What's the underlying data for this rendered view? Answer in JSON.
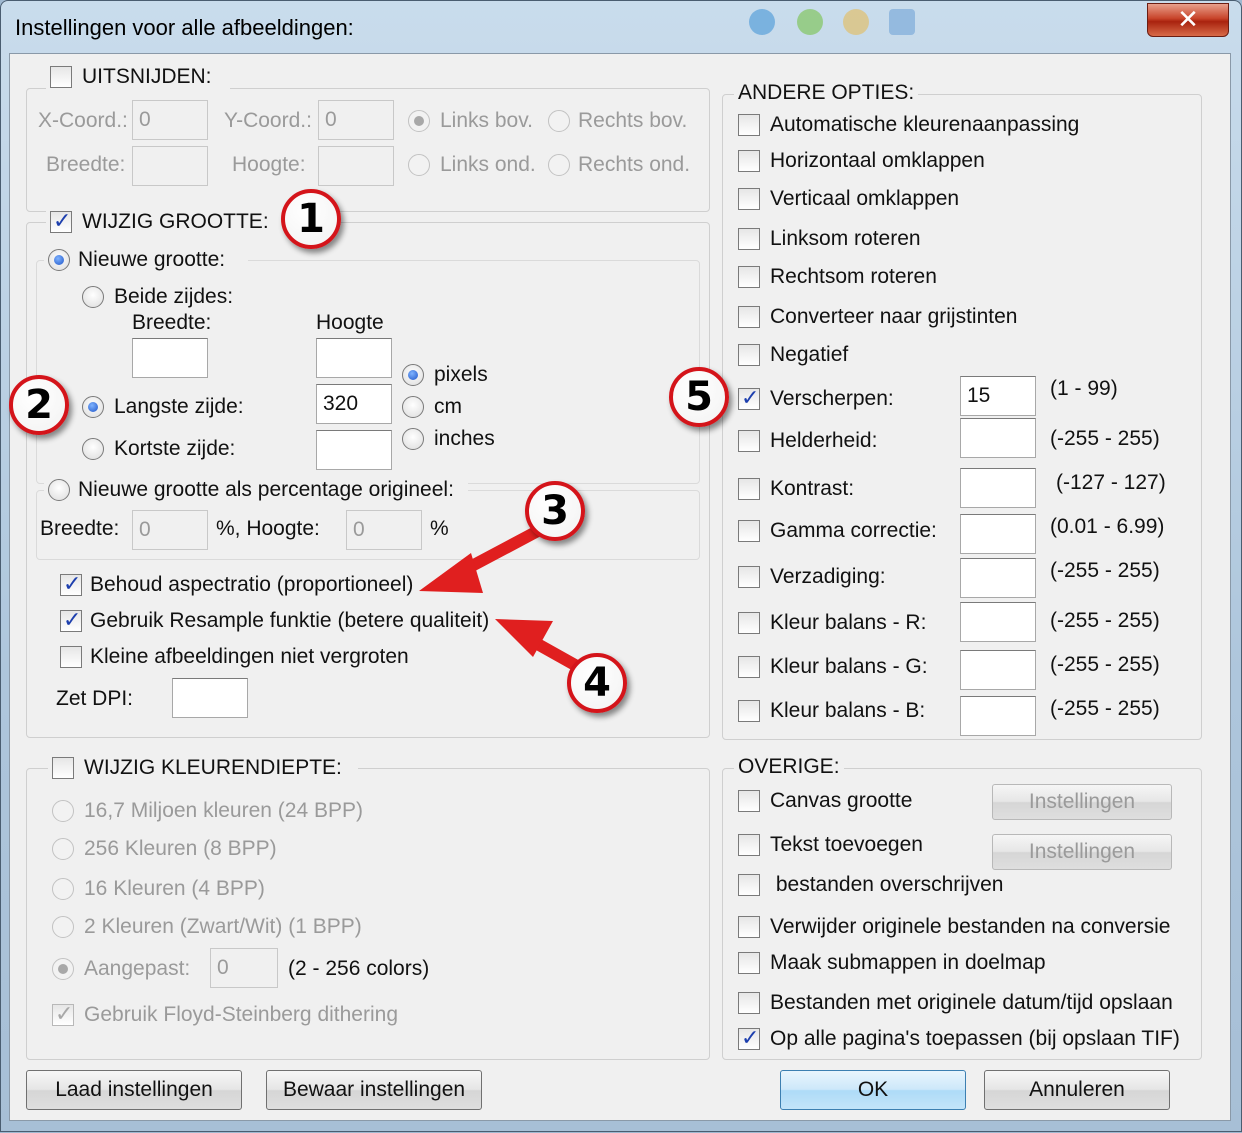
{
  "window": {
    "title": "Instellingen voor alle afbeeldingen:",
    "close_glyph": "✕"
  },
  "crop": {
    "heading": "UITSNIJDEN:",
    "x_label": "X-Coord.:",
    "x_value": "0",
    "y_label": "Y-Coord.:",
    "y_value": "0",
    "width_label": "Breedte:",
    "height_label": "Hoogte:",
    "radio_top_left": "Links bov.",
    "radio_top_right": "Rechts bov.",
    "radio_bottom_left": "Links ond.",
    "radio_bottom_right": "Rechts ond."
  },
  "resize": {
    "heading": "WIJZIG GROOTTE:",
    "new_size": "Nieuwe grootte:",
    "both_sides": "Beide zijdes:",
    "width_header": "Breedte:",
    "height_header": "Hoogte",
    "longest_side": "Langste zijde:",
    "longest_value": "320",
    "shortest_side": "Kortste zijde:",
    "unit_pixels": "pixels",
    "unit_cm": "cm",
    "unit_inches": "inches",
    "percent_option": "Nieuwe grootte als percentage origineel:",
    "pct_width_label": "Breedte:",
    "pct_width_value": "0",
    "pct_height_label": "%, Hoogte:",
    "pct_height_value": "0",
    "pct_symbol": "%",
    "keep_aspect": "Behoud aspectratio (proportioneel)",
    "resample": "Gebruik Resample funktie (betere qualiteit)",
    "no_enlarge": "Kleine afbeeldingen niet vergroten",
    "dpi_label": "Zet DPI:"
  },
  "color_depth": {
    "heading": "WIJZIG KLEURENDIEPTE:",
    "opt_24": "16,7 Miljoen kleuren (24 BPP)",
    "opt_8": "256 Kleuren (8 BPP)",
    "opt_4": "16 Kleuren (4 BPP)",
    "opt_1": "2 Kleuren (Zwart/Wit) (1 BPP)",
    "custom": "Aangepast:",
    "custom_value": "0",
    "custom_range": "(2 - 256 colors)",
    "dither": "Gebruik Floyd-Steinberg dithering"
  },
  "other_options": {
    "heading": "ANDERE OPTIES:",
    "auto_color": "Automatische kleurenaanpassing",
    "flip_h": "Horizontaal omklappen",
    "flip_v": "Verticaal omklappen",
    "rot_left": "Linksom roteren",
    "rot_right": "Rechtsom roteren",
    "grayscale": "Converteer naar grijstinten",
    "negative": "Negatief",
    "sharpen": "Verscherpen:",
    "sharpen_value": "15",
    "sharpen_range": "(1  -  99)",
    "brightness": "Helderheid:",
    "brightness_range": "(-255  -  255)",
    "contrast": "Kontrast:",
    "contrast_range": "(-127  -  127)",
    "gamma": "Gamma correctie:",
    "gamma_range": "(0.01  -  6.99)",
    "saturation": "Verzadiging:",
    "saturation_range": "(-255  -  255)",
    "bal_r": "Kleur balans - R:",
    "bal_r_range": "(-255  -  255)",
    "bal_g": "Kleur balans - G:",
    "bal_g_range": "(-255  -  255)",
    "bal_b": "Kleur balans - B:",
    "bal_b_range": "(-255  -  255)"
  },
  "misc": {
    "heading": "OVERIGE:",
    "canvas": "Canvas grootte",
    "canvas_btn": "Instellingen",
    "text": "Tekst toevoegen",
    "text_btn": "Instellingen",
    "overwrite": " bestanden overschrijven",
    "delete_orig": "Verwijder originele bestanden na conversie",
    "subfolders": "Maak submappen in doelmap",
    "keep_date": "Bestanden met originele datum/tijd opslaan",
    "all_pages": "Op alle pagina's toepassen (bij opslaan TIF)"
  },
  "footer": {
    "load": "Laad instellingen",
    "save": "Bewaar instellingen",
    "ok": "OK",
    "cancel": "Annuleren"
  },
  "annotations": {
    "b1": "1",
    "b2": "2",
    "b3": "3",
    "b4": "4",
    "b5": "5",
    "arrow_color": "#e01f1f"
  }
}
